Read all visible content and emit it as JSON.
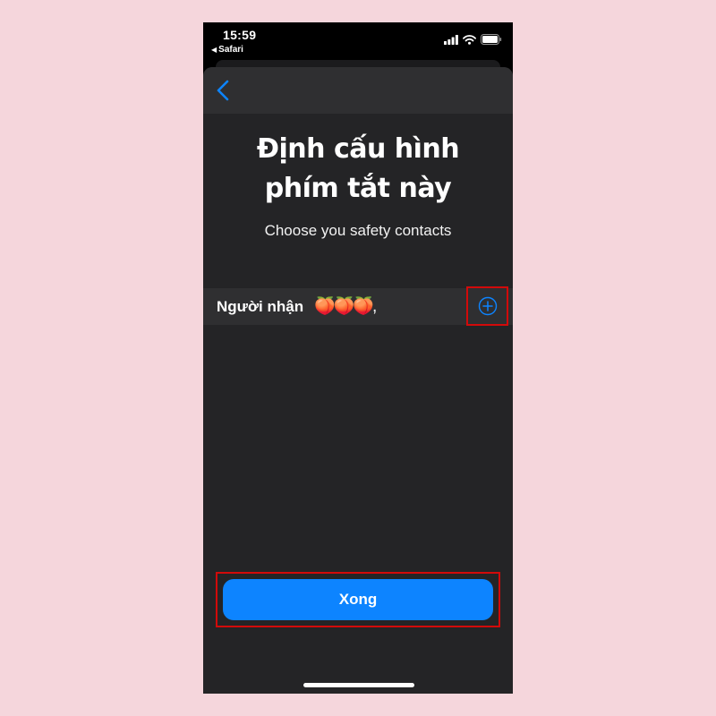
{
  "status_bar": {
    "time": "15:59",
    "back_app": "Safari",
    "back_arrow": "◀"
  },
  "nav": {
    "back_icon": "chevron-left-icon"
  },
  "header": {
    "title_line1": "Định cấu hình",
    "title_line2": "phím tắt này",
    "subtitle": "Choose you safety contacts"
  },
  "recipient": {
    "label": "Người nhận",
    "value": "🍑🍑🍑,",
    "add_icon": "plus-circle-icon"
  },
  "done_button": {
    "label": "Xong"
  },
  "colors": {
    "accent": "#0d84ff",
    "sheet_background": "#242426",
    "highlight": "#d20a0a",
    "page_background": "#f5d6dc"
  }
}
